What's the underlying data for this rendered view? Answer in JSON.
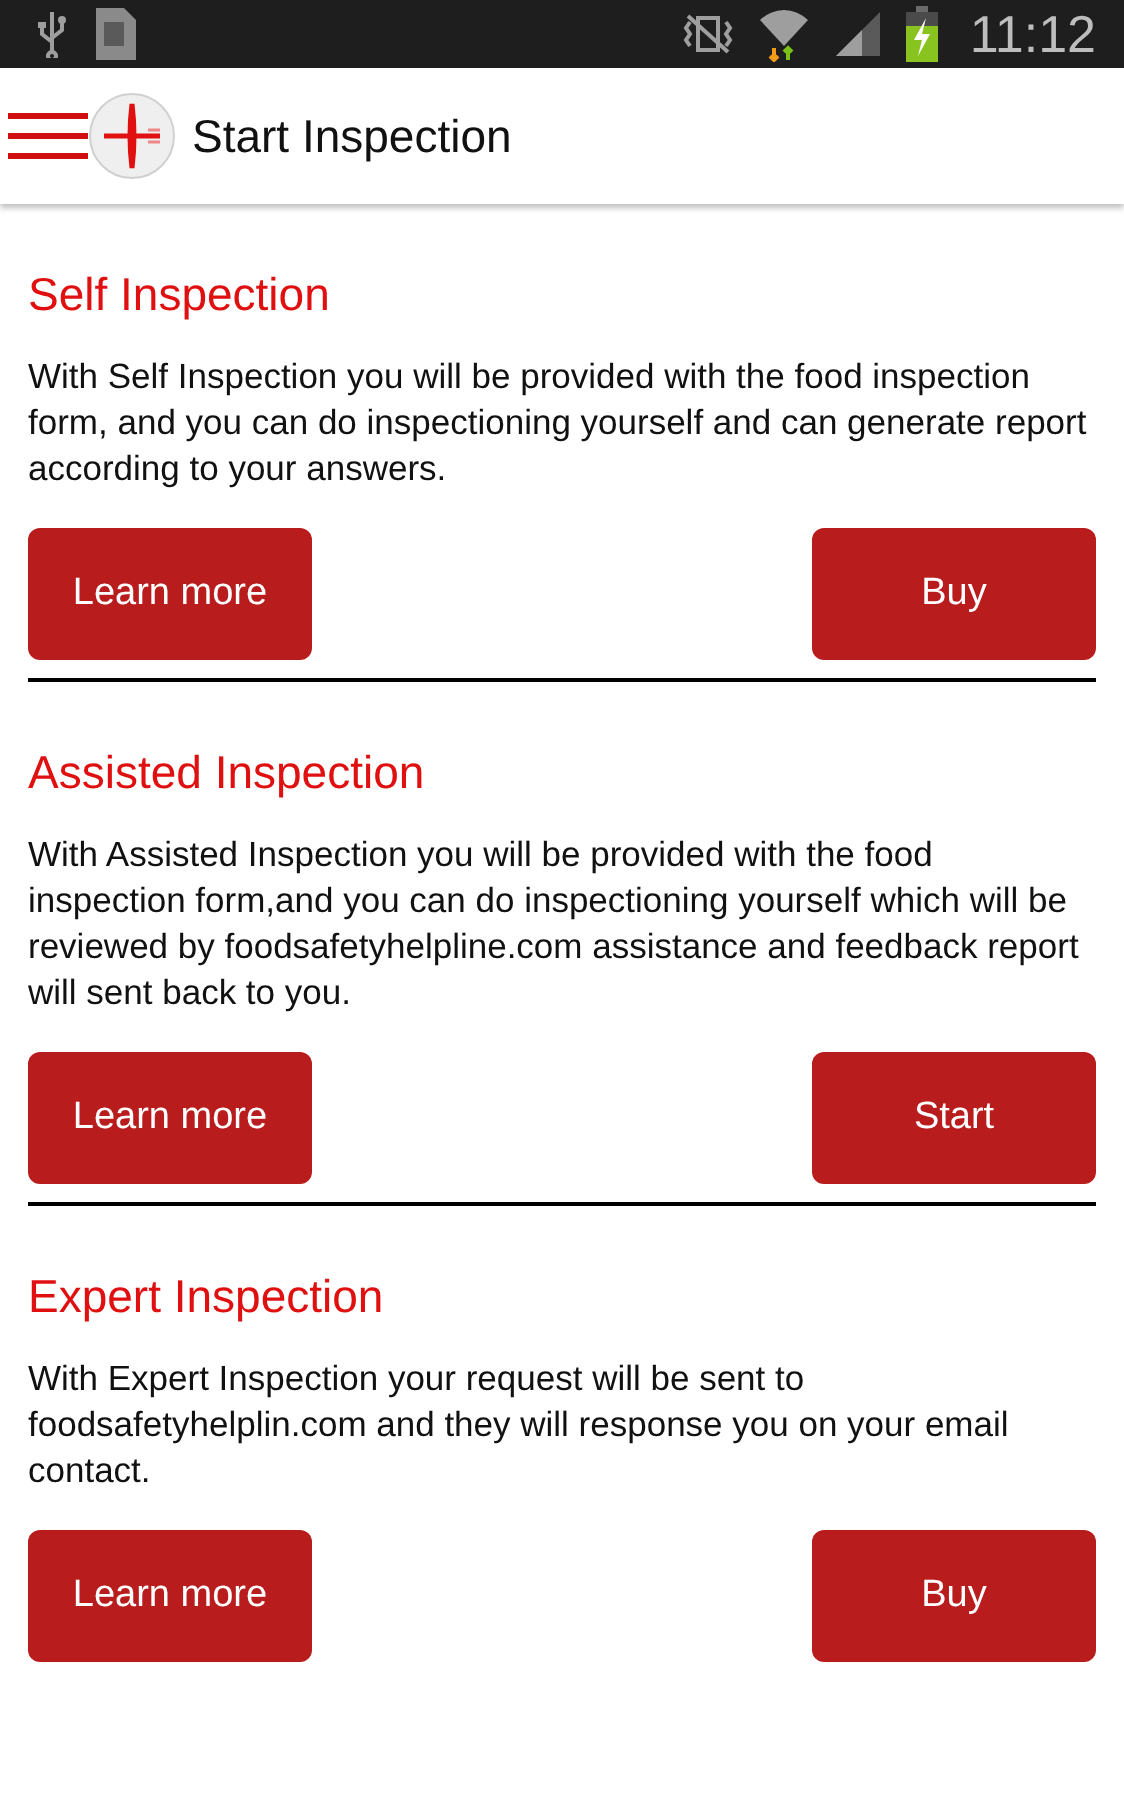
{
  "status_bar": {
    "time": "11:12"
  },
  "app_bar": {
    "title": "Start Inspection"
  },
  "sections": [
    {
      "title": "Self Inspection",
      "description": "With Self Inspection you will be provided with the food inspection form, and you can do inspectioning yourself and can generate report according to your answers.",
      "buttons": [
        "Learn more",
        "Buy"
      ]
    },
    {
      "title": "Assisted Inspection",
      "description": "With Assisted Inspection you will be provided with the food inspection form,and you can do inspectioning yourself which will be reviewed by foodsafetyhelpline.com assistance and feedback report will sent back to you.",
      "buttons": [
        "Learn more",
        "Start"
      ]
    },
    {
      "title": "Expert Inspection",
      "description": "With Expert Inspection your request will be sent to foodsafetyhelplin.com and they will response you on your email contact.",
      "buttons": [
        "Learn more",
        "Buy"
      ]
    }
  ]
}
